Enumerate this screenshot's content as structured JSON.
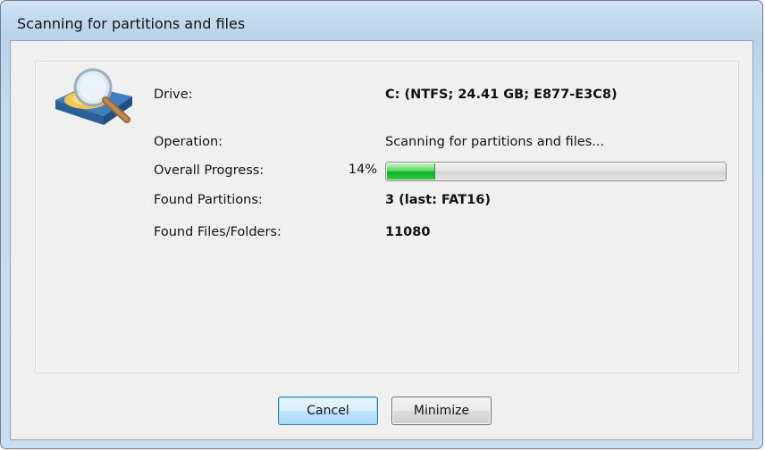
{
  "window": {
    "title": "Scanning for partitions and files"
  },
  "icon": {
    "name": "hard-drive-magnifier-icon"
  },
  "fields": {
    "drive_label": "Drive:",
    "drive_value": "C: (NTFS; 24.41 GB; E877-E3C8)",
    "operation_label": "Operation:",
    "operation_value": "Scanning for partitions and files...",
    "progress_label": "Overall Progress:",
    "progress_text": "14%",
    "progress_value": 0.14,
    "partitions_label": "Found Partitions:",
    "partitions_value": "3 (last: FAT16)",
    "files_label": "Found Files/Folders:",
    "files_value": "11080"
  },
  "buttons": {
    "cancel": "Cancel",
    "minimize": "Minimize"
  },
  "colors": {
    "progress_green": "#06b025",
    "window_frame": "#c6dcef"
  }
}
